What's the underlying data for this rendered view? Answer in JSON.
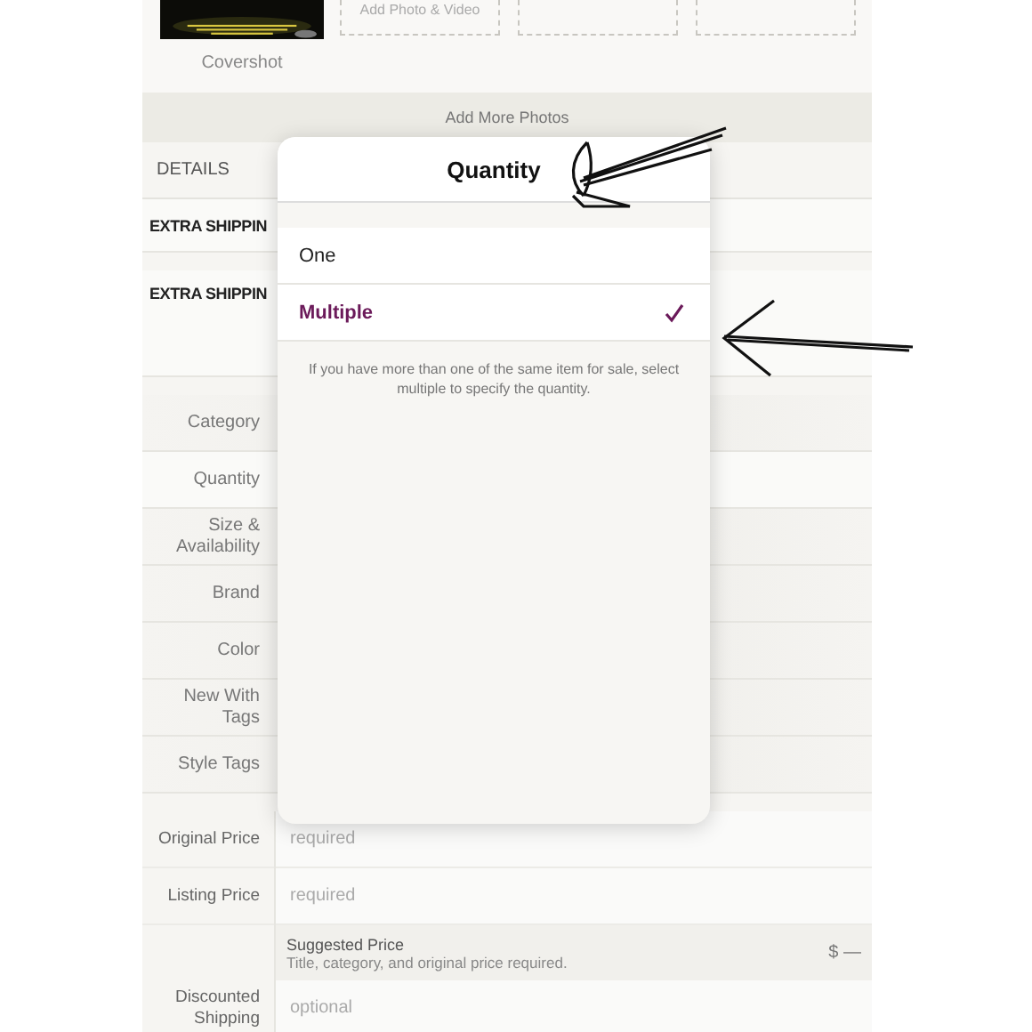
{
  "photo_slots": [
    {
      "kind": "cover",
      "label": "Covershot"
    },
    {
      "kind": "add",
      "label": "Add Photo & Video"
    },
    {
      "kind": "empty"
    },
    {
      "kind": "empty"
    }
  ],
  "add_more": "Add More Photos",
  "details_header": "DETAILS",
  "extra_rows": [
    {
      "label": "EXTRA SHIPPIN"
    },
    {
      "label": "EXTRA SHIPPIN"
    }
  ],
  "form_rows": [
    {
      "label": "Category",
      "selected": false
    },
    {
      "label": "Quantity",
      "selected": true
    },
    {
      "label": "Size & Availability",
      "selected": false
    },
    {
      "label": "Brand",
      "selected": false
    },
    {
      "label": "Color",
      "selected": false
    },
    {
      "label": "New With Tags",
      "selected": false
    },
    {
      "label": "Style Tags",
      "selected": false
    }
  ],
  "price_rows": [
    {
      "label": "Original Price",
      "placeholder": "required"
    },
    {
      "label": "Listing Price",
      "placeholder": "required"
    }
  ],
  "suggested": {
    "title": "Suggested Price",
    "note": "Title, category, and original price required.",
    "value": "$ —"
  },
  "discount_row": {
    "label": "Discounted Shipping",
    "placeholder": "optional"
  },
  "popover": {
    "title": "Quantity",
    "options": [
      {
        "label": "One",
        "selected": false
      },
      {
        "label": "Multiple",
        "selected": true
      }
    ],
    "hint": "If you have more than one of the same item for sale, select multiple to specify the quantity."
  }
}
